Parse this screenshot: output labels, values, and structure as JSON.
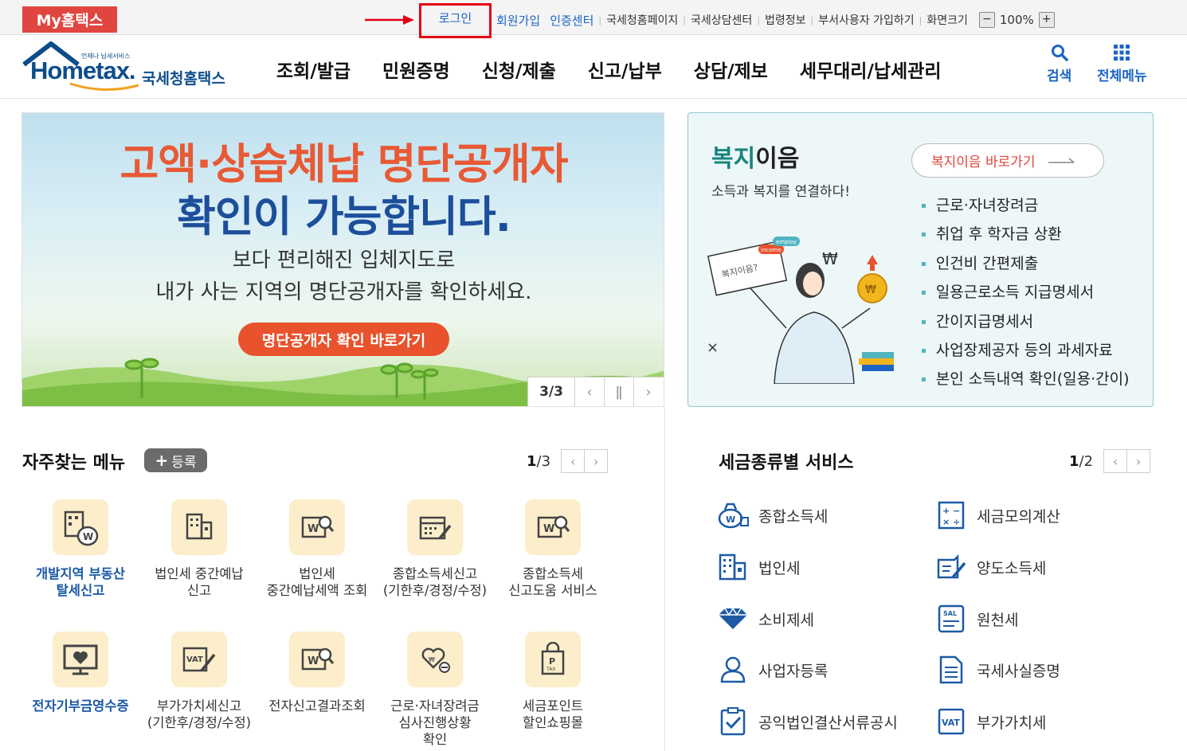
{
  "topbar": {
    "my_label": "My홈택스",
    "login": "로그인",
    "links": [
      "회원가입",
      "인증센터",
      "국세청홈페이지",
      "국세상담센터",
      "법령정보",
      "부서사용자 가입하기",
      "화면크기"
    ],
    "zoom_minus": "−",
    "zoom_value": "100%",
    "zoom_plus": "+"
  },
  "header": {
    "logo_small": "언제나 납세서비스",
    "logo_main": "Hometax.",
    "logo_kor": "국세청홈택스",
    "nav": [
      "조회/발급",
      "민원증명",
      "신청/제출",
      "신고/납부",
      "상담/제보",
      "세무대리/납세관리"
    ],
    "search_label": "검색",
    "all_menu_label": "전체메뉴"
  },
  "banner": {
    "title1": "고액·상습체납 명단공개자",
    "title2": "확인이 가능합니다.",
    "sub1": "보다 편리해진 입체지도로",
    "sub2": "내가 사는 지역의 명단공개자를 확인하세요.",
    "button": "명단공개자 확인 바로가기",
    "page": "3/3"
  },
  "welfare": {
    "title_a": "복지",
    "title_b": "이음",
    "subtitle": "소득과 복지를 연결하다!",
    "go_button": "복지이음 바로가기",
    "items": [
      "근로·자녀장려금",
      "취업 후 학자금 상환",
      "인건비 간편제출",
      "일용근로소득 지급명세서",
      "간이지급명세서",
      "사업장제공자 등의 과세자료",
      "본인 소득내역 확인(일용·간이)"
    ],
    "illu_tags": [
      "복지이음?",
      "income",
      "employ"
    ]
  },
  "favorites": {
    "title": "자주찾는 메뉴",
    "register": "등록",
    "page_current": "1",
    "page_total": "/3",
    "items": [
      {
        "label": "개발지역 부동산\n탈세신고",
        "icon": "building-money-bag-icon",
        "highlight": true
      },
      {
        "label": "법인세 중간예납\n신고",
        "icon": "building-icon",
        "highlight": false
      },
      {
        "label": "법인세\n중간예납세액 조회",
        "icon": "document-search-icon",
        "highlight": false
      },
      {
        "label": "종합소득세신고\n(기한후/경정/수정)",
        "icon": "calendar-pen-icon",
        "highlight": false
      },
      {
        "label": "종합소득세\n신고도움 서비스",
        "icon": "document-search-icon",
        "highlight": false
      },
      {
        "label": "전자기부금영수증",
        "icon": "monitor-heart-icon",
        "highlight": true
      },
      {
        "label": "부가가치세신고\n(기한후/경정/수정)",
        "icon": "vat-pen-icon",
        "highlight": false
      },
      {
        "label": "전자신고결과조회",
        "icon": "document-search-icon",
        "highlight": false
      },
      {
        "label": "근로·자녀장려금\n심사진행상황\n확인",
        "icon": "heart-hand-icon",
        "highlight": false
      },
      {
        "label": "세금포인트\n할인쇼핑몰",
        "icon": "shopping-bag-icon",
        "highlight": false
      }
    ]
  },
  "tax_services": {
    "title": "세금종류별 서비스",
    "page_current": "1",
    "page_total": "/2",
    "items": [
      {
        "label": "종합소득세",
        "icon": "money-bag-icon"
      },
      {
        "label": "세금모의계산",
        "icon": "calculator-icon"
      },
      {
        "label": "법인세",
        "icon": "building-icon"
      },
      {
        "label": "양도소득세",
        "icon": "document-pen-icon"
      },
      {
        "label": "소비제세",
        "icon": "diamond-icon"
      },
      {
        "label": "원천세",
        "icon": "salary-document-icon"
      },
      {
        "label": "사업자등록",
        "icon": "person-icon"
      },
      {
        "label": "국세사실증명",
        "icon": "document-icon"
      },
      {
        "label": "공익법인결산서류공시",
        "icon": "clipboard-check-icon"
      },
      {
        "label": "부가가치세",
        "icon": "vat-icon"
      }
    ]
  },
  "colors": {
    "accent_red": "#e0453f",
    "brand_blue": "#1c65c6",
    "teal": "#17857c",
    "icon_bg": "#fdeecb"
  }
}
